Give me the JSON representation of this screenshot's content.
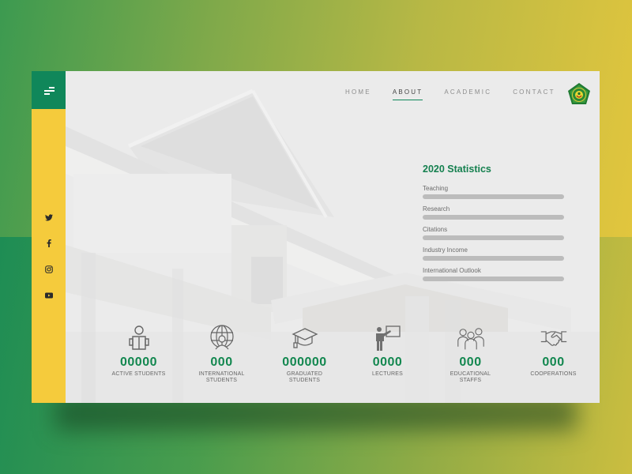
{
  "colors": {
    "brand_green": "#10875a",
    "brand_yellow": "#f5cb3c",
    "stat_title": "#15804f",
    "bar_track": "#bcbcbc"
  },
  "sidebar": {
    "menu_icon": "menu-icon",
    "social": [
      {
        "name": "twitter",
        "icon": "twitter-icon"
      },
      {
        "name": "facebook",
        "icon": "facebook-icon"
      },
      {
        "name": "instagram",
        "icon": "instagram-icon"
      },
      {
        "name": "youtube",
        "icon": "youtube-icon"
      }
    ]
  },
  "nav": {
    "items": [
      {
        "label": "HOME",
        "active": false
      },
      {
        "label": "ABOUT",
        "active": true
      },
      {
        "label": "ACADEMIC",
        "active": false
      },
      {
        "label": "CONTACT",
        "active": false
      }
    ],
    "logo": "university-emblem-logo"
  },
  "statistics": {
    "title": "2020 Statistics",
    "items": [
      {
        "label": "Teaching",
        "progress": 0
      },
      {
        "label": "Research",
        "progress": 0
      },
      {
        "label": "Citations",
        "progress": 0
      },
      {
        "label": "Industry Income",
        "progress": 0
      },
      {
        "label": "International Outlook",
        "progress": 0
      }
    ]
  },
  "counters": [
    {
      "icon": "reading-student-icon",
      "value": "00000",
      "label": "ACTIVE STUDENTS"
    },
    {
      "icon": "globe-person-icon",
      "value": "000",
      "label": "INTERNATIONAL STUDENTS"
    },
    {
      "icon": "graduation-cap-icon",
      "value": "000000",
      "label": "GRADUATED STUDENTS"
    },
    {
      "icon": "lecturer-board-icon",
      "value": "0000",
      "label": "LECTURES"
    },
    {
      "icon": "staff-group-icon",
      "value": "000",
      "label": "EDUCATIONAL STAFFS"
    },
    {
      "icon": "handshake-icon",
      "value": "000",
      "label": "COOPERATIONS"
    }
  ]
}
